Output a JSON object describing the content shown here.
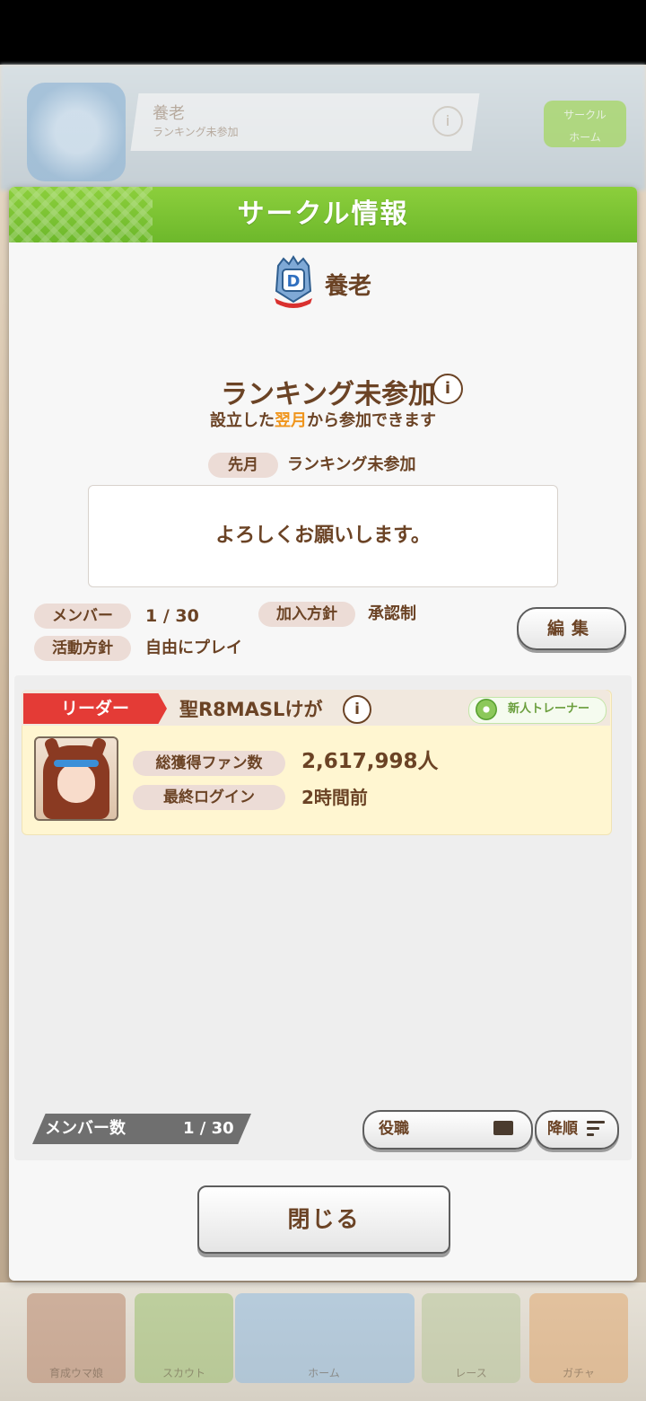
{
  "background": {
    "header_name": "養老",
    "header_sub": "ランキング未参加",
    "green_button": [
      "サークル",
      "ホーム"
    ],
    "nav_labels": [
      "育成ウマ娘",
      "スカウト",
      "ホーム",
      "レース",
      "ガチャ"
    ]
  },
  "dialog": {
    "title": "サークル情報",
    "circle_name": "養老",
    "ranking_status": "ランキング未参加",
    "info_icon": "i",
    "ranking_note_before": "設立した",
    "ranking_note_highlight": "翌月",
    "ranking_note_after": "から参加できます",
    "last_month_label": "先月",
    "last_month_value": "ランキング未参加",
    "comment": "よろしくお願いします。",
    "members_label": "メンバー",
    "members_value": "1 / 30",
    "join_policy_label": "加入方針",
    "join_policy_value": "承認制",
    "activity_label": "活動方針",
    "activity_value": "自由にプレイ",
    "edit_button": "編集",
    "member_card": {
      "role": "リーダー",
      "name": "聖R8MASLけが",
      "rank_badge": "新人トレーナー",
      "fans_label": "総獲得ファン数",
      "fans_value": "2,617,998人",
      "login_label": "最終ログイン",
      "login_value": "2時間前"
    },
    "member_count_label": "メンバー数",
    "member_count_value": "1 / 30",
    "role_button": "役職",
    "sort_button": "降順",
    "close_button": "閉じる"
  },
  "colors": {
    "header_green": "#7ac232",
    "text_brown": "#6b4325",
    "highlight_orange": "#f0951c",
    "leader_red": "#e43b36"
  }
}
